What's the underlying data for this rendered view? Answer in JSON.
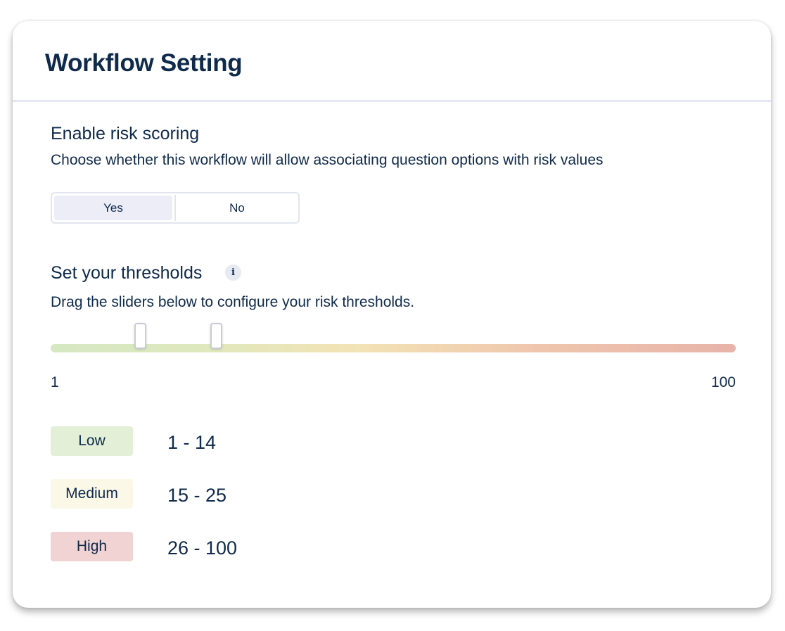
{
  "card": {
    "title": "Workflow Setting"
  },
  "risk_scoring": {
    "title": "Enable risk scoring",
    "description": "Choose whether this workflow will allow associating question options with risk values",
    "options": [
      "Yes",
      "No"
    ],
    "selected": "Yes"
  },
  "thresholds": {
    "title": "Set your thresholds",
    "info_icon": "info-icon",
    "description": "Drag the sliders below to configure your risk thresholds.",
    "min_label": "1",
    "max_label": "100",
    "min": 1,
    "max": 100,
    "handles": [
      14,
      25
    ],
    "levels": [
      {
        "label": "Low",
        "range": "1 - 14",
        "color": "#e3f0d7"
      },
      {
        "label": "Medium",
        "range": "15 - 25",
        "color": "#fcf8e8"
      },
      {
        "label": "High",
        "range": "26 - 100",
        "color": "#f0d3d2"
      }
    ]
  }
}
